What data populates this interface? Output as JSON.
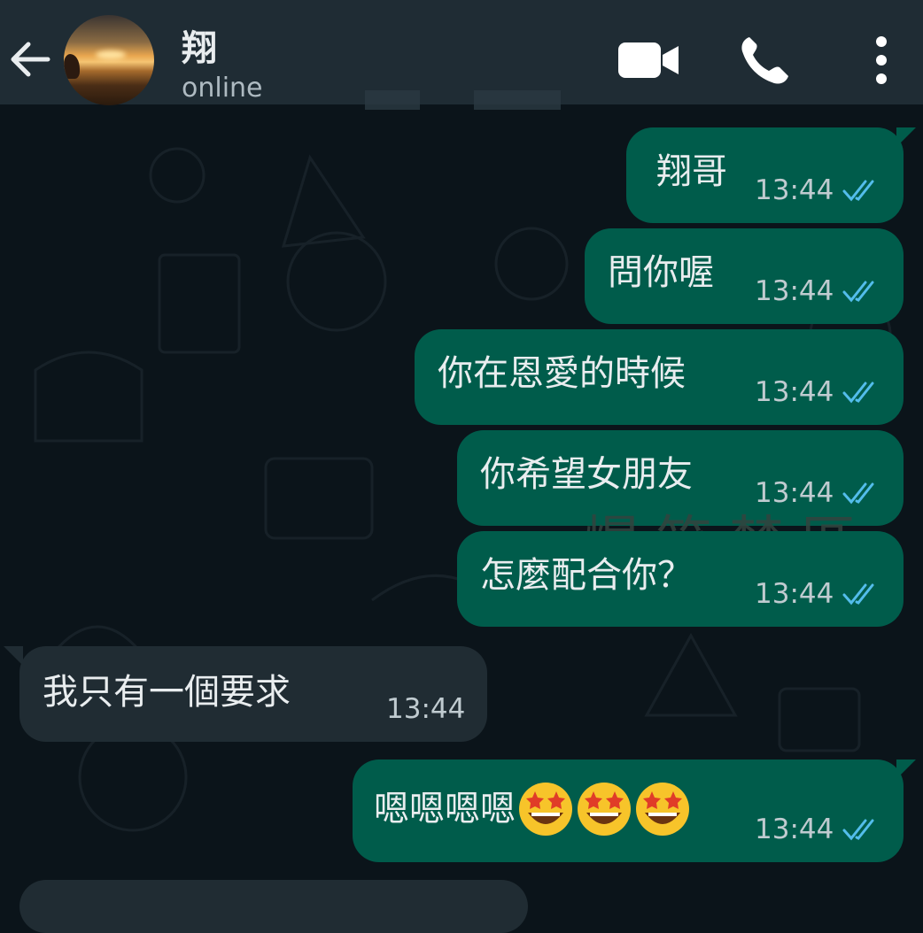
{
  "header": {
    "contact_name": "翔",
    "status": "online"
  },
  "icons": {
    "back": "arrow-left-icon",
    "video": "video-camera-icon",
    "call": "phone-icon",
    "menu": "more-vertical-icon"
  },
  "colors": {
    "outgoing_bubble": "#005c4b",
    "incoming_bubble": "#202c33",
    "header": "#1f2c34",
    "background": "#0b141a",
    "read_ticks": "#53bdeb"
  },
  "messages": [
    {
      "direction": "out",
      "text": "翔哥",
      "time": "13:44",
      "read": true
    },
    {
      "direction": "out",
      "text": "問你喔",
      "time": "13:44",
      "read": true
    },
    {
      "direction": "out",
      "text": "你在恩愛的時候",
      "time": "13:44",
      "read": true
    },
    {
      "direction": "out",
      "text": "你希望女朋友",
      "time": "13:44",
      "read": true
    },
    {
      "direction": "out",
      "text": "怎麼配合你？",
      "time": "13:44",
      "read": true
    },
    {
      "direction": "in",
      "text": "我只有一個要求",
      "time": "13:44"
    },
    {
      "direction": "out",
      "text": "嗯嗯嗯嗯",
      "emoji": [
        "star-struck-emoji",
        "star-struck-emoji",
        "star-struck-emoji"
      ],
      "time": "13:44",
      "read": true
    },
    {
      "direction": "in",
      "text": "",
      "time": ""
    }
  ],
  "watermark": "爆笑禁區"
}
